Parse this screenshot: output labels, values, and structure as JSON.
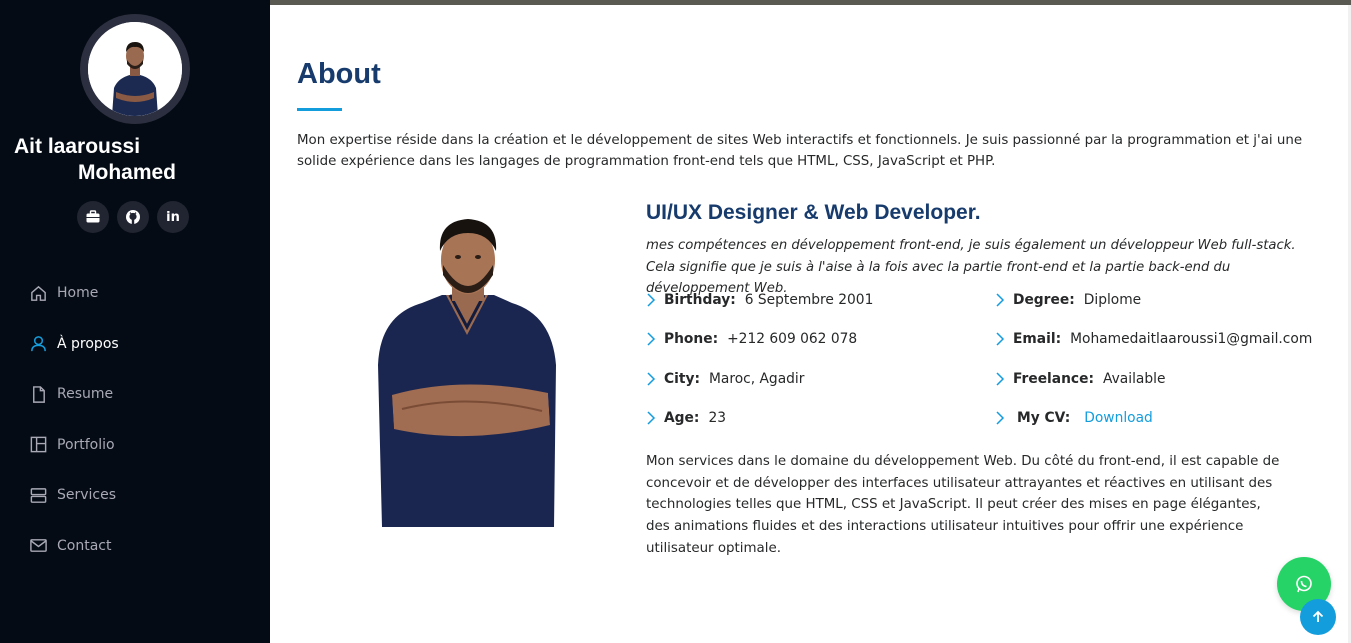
{
  "profile": {
    "name_line1": "Ait laaroussi",
    "name_line2": "Mohamed"
  },
  "socials": [
    {
      "icon": "briefcase-icon"
    },
    {
      "icon": "github-icon"
    },
    {
      "icon": "linkedin-icon",
      "text": "in"
    }
  ],
  "nav": [
    {
      "label": "Home",
      "icon": "home-icon"
    },
    {
      "label": "À propos",
      "icon": "person-icon",
      "active": true
    },
    {
      "label": "Resume",
      "icon": "file-icon"
    },
    {
      "label": "Portfolio",
      "icon": "layout-icon"
    },
    {
      "label": "Services",
      "icon": "server-icon"
    },
    {
      "label": "Contact",
      "icon": "envelope-icon"
    }
  ],
  "about": {
    "title": "About",
    "intro": "Mon expertise réside dans la création et le développement de sites Web interactifs et fonctionnels. Je suis passionné par la programmation et j'ai une solide expérience dans les langages de programmation front-end tels que HTML, CSS, JavaScript et PHP.",
    "role": "UI/UX Designer & Web Developer.",
    "role_desc": "mes compétences en développement front-end, je suis également un développeur Web full-stack. Cela signifie que je suis à l'aise à la fois avec la partie front-end et la partie back-end du développement Web.",
    "facts_left": [
      {
        "label": "Birthday:",
        "value": "6 Septembre 2001"
      },
      {
        "label": "Phone:",
        "value": "+212 609 062 078"
      },
      {
        "label": "City:",
        "value": "Maroc, Agadir"
      },
      {
        "label": "Age:",
        "value": "23"
      }
    ],
    "facts_right": [
      {
        "label": "Degree:",
        "value": "Diplome"
      },
      {
        "label": "Email:",
        "value": "Mohamedaitlaaroussi1@gmail.com"
      },
      {
        "label": "Freelance:",
        "value": "Available"
      },
      {
        "label": "My CV:",
        "value": "Download"
      }
    ],
    "services": "Mon services dans le domaine du développement Web. Du côté du front-end, il est capable de concevoir et de développer des interfaces utilisateur attrayantes et réactives en utilisant des technologies telles que HTML, CSS et JavaScript. Il peut créer des mises en page élégantes, des animations fluides et des interactions utilisateur intuitives pour offrir une expérience utilisateur optimale."
  },
  "colors": {
    "sidebar_bg": "#040b14",
    "accent": "#149ddd",
    "heading": "#173b6c",
    "whatsapp": "#25d366"
  }
}
